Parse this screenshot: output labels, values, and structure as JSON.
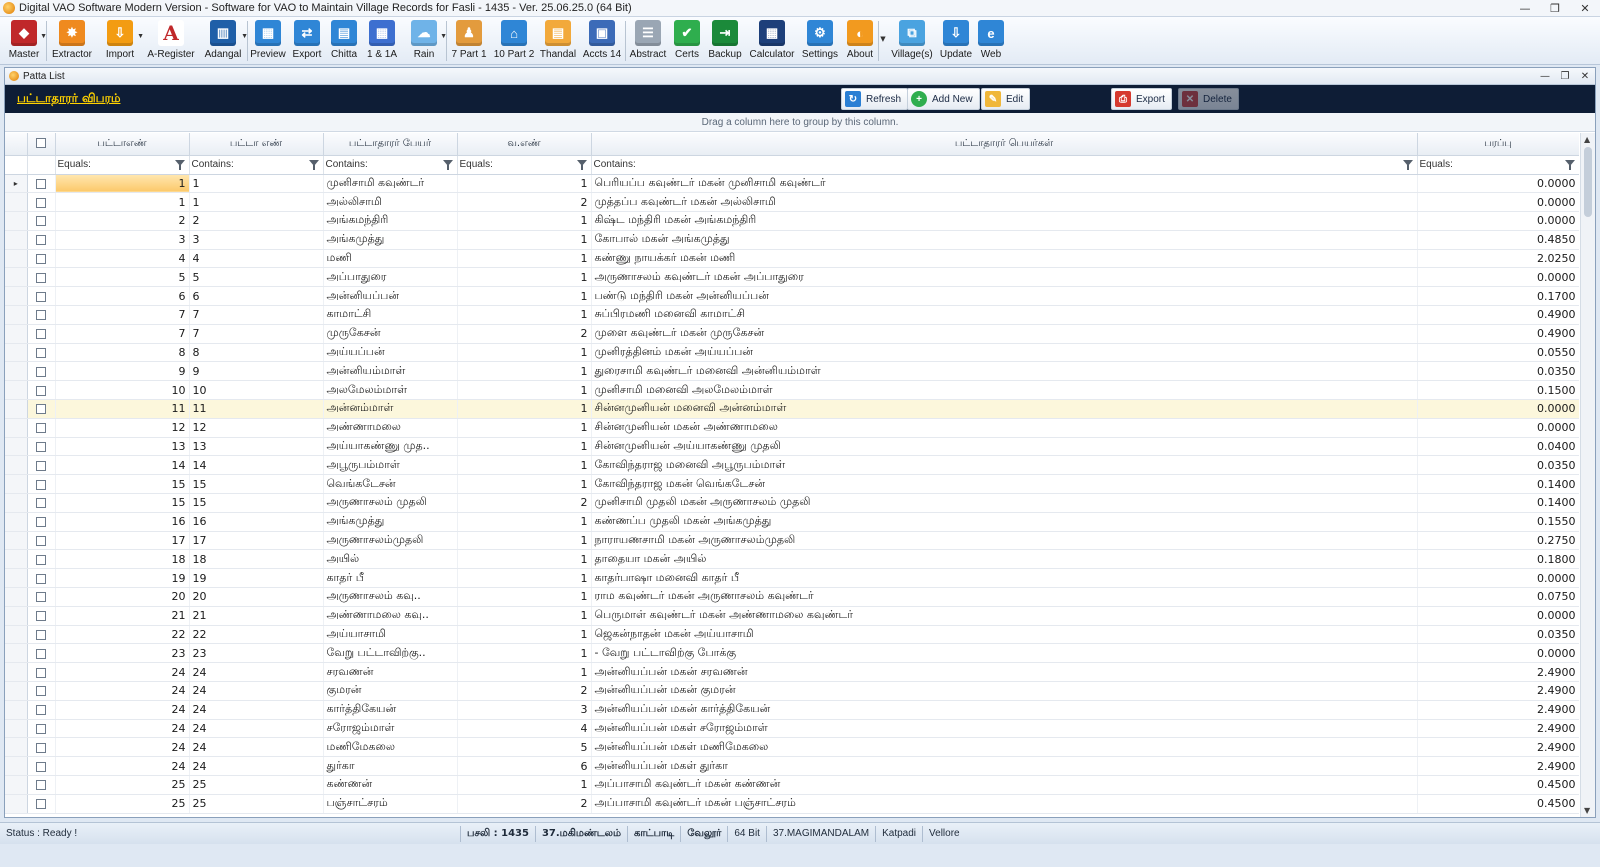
{
  "window": {
    "title": "Digital VAO Software Modern Version - Software for VAO to Maintain Village Records for Fasli - 1435 - Ver. 25.06.25.0 (64 Bit)",
    "controls": [
      "—",
      "❐",
      "✕"
    ]
  },
  "ribbon": [
    {
      "label": "Master",
      "icon": "master-icon",
      "color": "#c0282a",
      "glyph": "◆",
      "dropdown": true
    },
    {
      "label": "Extractor",
      "icon": "extractor-icon",
      "color": "#ef8a1f",
      "glyph": "✸",
      "dropdown": false
    },
    {
      "label": "Import",
      "icon": "import-icon",
      "color": "#f39c12",
      "glyph": "⇩",
      "dropdown": true
    },
    {
      "label": "A-Register",
      "icon": "a-register-icon",
      "color": "#ffffff",
      "glyph": "A",
      "dropdown": false
    },
    {
      "label": "Adangal",
      "icon": "adangal-icon",
      "color": "#1f5fa8",
      "glyph": "▥",
      "dropdown": true
    },
    {
      "label": "Preview",
      "icon": "preview-icon",
      "color": "#2f86d6",
      "glyph": "▦",
      "dropdown": false
    },
    {
      "label": "Export",
      "icon": "export-icon",
      "color": "#2f86d6",
      "glyph": "⇄",
      "dropdown": false
    },
    {
      "label": "Chitta",
      "icon": "chitta-icon",
      "color": "#2f86d6",
      "glyph": "▤",
      "dropdown": false
    },
    {
      "label": "1 & 1A",
      "icon": "one-and-one-a-icon",
      "color": "#3d6fd0",
      "glyph": "▦",
      "dropdown": false
    },
    {
      "label": "Rain",
      "icon": "rain-icon",
      "color": "#6fb3e8",
      "glyph": "☁",
      "dropdown": true
    },
    {
      "label": "7 Part 1",
      "icon": "seven-part-1-icon",
      "color": "#e39b3d",
      "glyph": "♟",
      "dropdown": false
    },
    {
      "label": "10 Part 2",
      "icon": "ten-part-2-icon",
      "color": "#2f86d6",
      "glyph": "⌂",
      "dropdown": false
    },
    {
      "label": "Thandal",
      "icon": "thandal-icon",
      "color": "#f2a93b",
      "glyph": "▤",
      "dropdown": false
    },
    {
      "label": "Accts 14",
      "icon": "accts-14-icon",
      "color": "#3c6bb8",
      "glyph": "▣",
      "dropdown": false
    },
    {
      "label": "Abstract",
      "icon": "abstract-icon",
      "color": "#9aa6b4",
      "glyph": "☰",
      "dropdown": false
    },
    {
      "label": "Certs",
      "icon": "certs-icon",
      "color": "#2fae4e",
      "glyph": "✔",
      "dropdown": false
    },
    {
      "label": "Backup",
      "icon": "backup-icon",
      "color": "#1b8a3a",
      "glyph": "⇥",
      "dropdown": false
    },
    {
      "label": "Calculator",
      "icon": "calculator-icon",
      "color": "#1d3f7a",
      "glyph": "▦",
      "dropdown": false
    },
    {
      "label": "Settings",
      "icon": "settings-icon",
      "color": "#2f86d6",
      "glyph": "⚙",
      "dropdown": false
    },
    {
      "label": "About",
      "icon": "about-icon",
      "color": "#f29a1f",
      "glyph": "◐",
      "dropdown": false
    },
    {
      "label": "Village(s)",
      "icon": "villages-icon",
      "color": "#4aa3e0",
      "glyph": "⧉",
      "dropdown": false
    },
    {
      "label": "Update",
      "icon": "update-icon",
      "color": "#2f86d6",
      "glyph": "⇩",
      "dropdown": false
    },
    {
      "label": "Web",
      "icon": "web-icon",
      "color": "#2f86d6",
      "glyph": "e",
      "dropdown": false
    }
  ],
  "panel": {
    "title": "Patta List",
    "heading": "பட்டாதாரர் விபரம்",
    "actions": {
      "refresh": "Refresh",
      "add_new": "Add New",
      "edit": "Edit",
      "export": "Export",
      "delete": "Delete"
    },
    "group_hint": "Drag a column here to group by this column."
  },
  "grid": {
    "columns": [
      "பட்டாஎண்",
      "பட்டா எண்",
      "பட்டாதாரர் பேயர்",
      "வ.எண்",
      "பட்டாதாரர் பெயர்கள்",
      "பரப்பு"
    ],
    "filters": [
      "Equals:",
      "Contains:",
      "Contains:",
      "Equals:",
      "Contains:",
      "Equals:"
    ],
    "rows": [
      {
        "n": "1",
        "p": "1",
        "name": "முனிசாமி கவுண்டர்",
        "v": "1",
        "full": "பெரியப்ப கவுண்டர் மகன் முனிசாமி கவுண்டர்",
        "area": "0.0000"
      },
      {
        "n": "1",
        "p": "1",
        "name": "அல்லிசாமி",
        "v": "2",
        "full": "முத்தப்ப  கவுண்டர் மகன் அல்லிசாமி",
        "area": "0.0000"
      },
      {
        "n": "2",
        "p": "2",
        "name": "அங்கமந்திரி",
        "v": "1",
        "full": "கிஷ்ட மந்திரி மகன் அங்கமந்திரி",
        "area": "0.0000"
      },
      {
        "n": "3",
        "p": "3",
        "name": "அங்கமுத்து",
        "v": "1",
        "full": "கோபால் மகன் அங்கமுத்து",
        "area": "0.4850"
      },
      {
        "n": "4",
        "p": "4",
        "name": "மணி",
        "v": "1",
        "full": "கண்ணு நாயக்கர் மகன் மணி",
        "area": "2.0250"
      },
      {
        "n": "5",
        "p": "5",
        "name": "அப்பாதுரை",
        "v": "1",
        "full": "அருணாசலம் கவுண்டர் மகன் அப்பாதுரை",
        "area": "0.0000"
      },
      {
        "n": "6",
        "p": "6",
        "name": "அன்னியப்பன்",
        "v": "1",
        "full": "பண்டு மந்திரி மகன் அன்னியப்பன்",
        "area": "0.1700"
      },
      {
        "n": "7",
        "p": "7",
        "name": "காமாட்சி",
        "v": "1",
        "full": "சுப்பிரமணி மனைவி காமாட்சி",
        "area": "0.4900"
      },
      {
        "n": "7",
        "p": "7",
        "name": "முருகேசன்",
        "v": "2",
        "full": "முளை கவுண்டர் மகன் முருகேசன்",
        "area": "0.4900"
      },
      {
        "n": "8",
        "p": "8",
        "name": "அய்யப்பன்",
        "v": "1",
        "full": "முனிரத்தினம் மகன் அய்யப்பன்",
        "area": "0.0550"
      },
      {
        "n": "9",
        "p": "9",
        "name": "அன்னியம்மாள்",
        "v": "1",
        "full": "துரைசாமி கவுண்டர் மனைவி அன்னியம்மாள்",
        "area": "0.0350"
      },
      {
        "n": "10",
        "p": "10",
        "name": "அலமேலம்மாள்",
        "v": "1",
        "full": "முனிசாமி மனைவி அலமேலம்மாள்",
        "area": "0.1500"
      },
      {
        "n": "11",
        "p": "11",
        "name": "அன்னம்மாள்",
        "v": "1",
        "full": "சின்னமுனியன் மனைவி அன்னம்மாள்",
        "area": "0.0000"
      },
      {
        "n": "12",
        "p": "12",
        "name": "அண்ணாமலை",
        "v": "1",
        "full": "சின்னமுனியன் மகன் அண்ணாமலை",
        "area": "0.0000"
      },
      {
        "n": "13",
        "p": "13",
        "name": "அய்யாகண்ணு முத..",
        "v": "1",
        "full": "சின்னமுனியன்  அய்யாகண்ணு முதலி",
        "area": "0.0400"
      },
      {
        "n": "14",
        "p": "14",
        "name": "அபூருபம்மாள்",
        "v": "1",
        "full": "கோவிந்தராஜ மனைவி அபூருபம்மாள்",
        "area": "0.0350"
      },
      {
        "n": "15",
        "p": "15",
        "name": "வெங்கடேசன்",
        "v": "1",
        "full": "கோவிந்தராஜ மகன் வெங்கடேசன்",
        "area": "0.1400"
      },
      {
        "n": "15",
        "p": "15",
        "name": "அருணாசலம் முதலி",
        "v": "2",
        "full": "முனிசாமி முதலி மகன் அருணாசலம் முதலி",
        "area": "0.1400"
      },
      {
        "n": "16",
        "p": "16",
        "name": "அங்கமுத்து",
        "v": "1",
        "full": "கண்ணப்ப முதலி மகன் அங்கமுத்து",
        "area": "0.1550"
      },
      {
        "n": "17",
        "p": "17",
        "name": "அருணாசலம்முதலி",
        "v": "1",
        "full": "நாராயணசாமி மகன் அருணாசலம்முதலி",
        "area": "0.2750"
      },
      {
        "n": "18",
        "p": "18",
        "name": "அயில்",
        "v": "1",
        "full": "தாதையா மகன் அயில்",
        "area": "0.1800"
      },
      {
        "n": "19",
        "p": "19",
        "name": "காதர் பீ",
        "v": "1",
        "full": "காதர்பாஷா மனைவி காதர் பீ",
        "area": "0.0000"
      },
      {
        "n": "20",
        "p": "20",
        "name": "அருணாசலம் கவு..",
        "v": "1",
        "full": "ராம கவுண்டர் மகன் அருணாசலம் கவுண்டர்",
        "area": "0.0750"
      },
      {
        "n": "21",
        "p": "21",
        "name": "அண்ணாமலை கவு..",
        "v": "1",
        "full": "பெருமாள் கவுண்டர் மகன் அண்ணாமலை கவுண்டர்",
        "area": "0.0000"
      },
      {
        "n": "22",
        "p": "22",
        "name": "அய்யாசாமி",
        "v": "1",
        "full": "ஜெகன்நாதன் மகன் அய்யாசாமி",
        "area": "0.0350"
      },
      {
        "n": "23",
        "p": "23",
        "name": "வேறு பட்டாவிற்கு..",
        "v": "1",
        "full": "-   வேறு பட்டாவிற்கு போக்கு",
        "area": "0.0000"
      },
      {
        "n": "24",
        "p": "24",
        "name": "சரவணன்",
        "v": "1",
        "full": "அன்னியப்பன் மகன் சரவணன்",
        "area": "2.4900"
      },
      {
        "n": "24",
        "p": "24",
        "name": "குமரன்",
        "v": "2",
        "full": "அன்னியப்பன் மகன் குமரன்",
        "area": "2.4900"
      },
      {
        "n": "24",
        "p": "24",
        "name": "கார்த்திகேயன்",
        "v": "3",
        "full": "அன்னியப்பன் மகன் கார்த்திகேயன்",
        "area": "2.4900"
      },
      {
        "n": "24",
        "p": "24",
        "name": "சரோஜம்மாள்",
        "v": "4",
        "full": "அன்னியப்பன் மகள் சரோஜம்மாள்",
        "area": "2.4900"
      },
      {
        "n": "24",
        "p": "24",
        "name": "மணிமேகலை",
        "v": "5",
        "full": "அன்னியப்பன் மகள் மணிமேகலை",
        "area": "2.4900"
      },
      {
        "n": "24",
        "p": "24",
        "name": "துர்கா",
        "v": "6",
        "full": "அன்னியப்பன் மகள் துர்கா",
        "area": "2.4900"
      },
      {
        "n": "25",
        "p": "25",
        "name": "கண்ணன்",
        "v": "1",
        "full": "அப்பாசாமி கவுண்டர் மகன் கண்ணன்",
        "area": "0.4500"
      },
      {
        "n": "25",
        "p": "25",
        "name": "பஞ்சாட்சரம்",
        "v": "2",
        "full": "அப்பாசாமி கவுண்டர் மகன் பஞ்சாட்சரம்",
        "area": "0.4500"
      }
    ],
    "current_row_marker": "▸",
    "selected_row_index": 12
  },
  "status": {
    "text": "Status : Ready !",
    "segments": [
      "பசலி  :  1435",
      "37.மகிமண்டலம்",
      "காட்பாடி",
      "வேலூர்",
      "64 Bit",
      "37.MAGIMANDALAM",
      "Katpadi",
      "Vellore"
    ]
  }
}
